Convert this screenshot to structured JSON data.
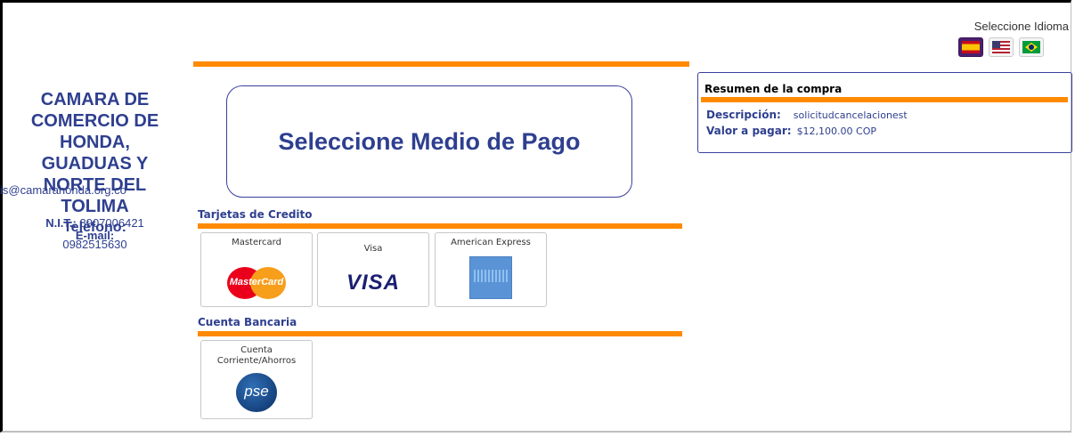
{
  "language": {
    "label": "Seleccione Idioma",
    "flags": [
      {
        "icon": "spain-flag-icon",
        "active": true
      },
      {
        "icon": "usa-flag-icon",
        "active": false
      },
      {
        "icon": "brazil-flag-icon",
        "active": false
      }
    ]
  },
  "company": {
    "name_lines": [
      "CAMARA DE",
      "COMERCIO DE",
      "HONDA,",
      "GUADUAS Y",
      "NORTE DEL",
      "TOLIMA"
    ],
    "nit_label": "N.I.T.:",
    "nit_value": "8907006421",
    "email_label": "E-mail:",
    "email_value": "is@camarahonda.org.co",
    "phone_label": "Teléfono:",
    "phone_value": "0982515630"
  },
  "main": {
    "title": "Seleccione Medio de Pago",
    "credit_section": "Tarjetas de Credito",
    "bank_section": "Cuenta Bancaria",
    "cards": [
      {
        "label": "Mastercard",
        "logo_text": "MasterCard"
      },
      {
        "label": "Visa",
        "logo_text": "VISA"
      },
      {
        "label": "American Express"
      }
    ],
    "bank": {
      "label_line1": "Cuenta",
      "label_line2": "Corriente/Ahorros",
      "logo_text": "pse"
    }
  },
  "summary": {
    "title": "Resumen de la compra",
    "description_label": "Descripción:",
    "description_value": "solicitudcancelacionest",
    "amount_label": "Valor a pagar:",
    "amount_value": "$12,100.00 COP"
  },
  "colors": {
    "accent": "#ff8a00",
    "brand_text": "#2e3f8f",
    "border": "#3b3f9e"
  }
}
